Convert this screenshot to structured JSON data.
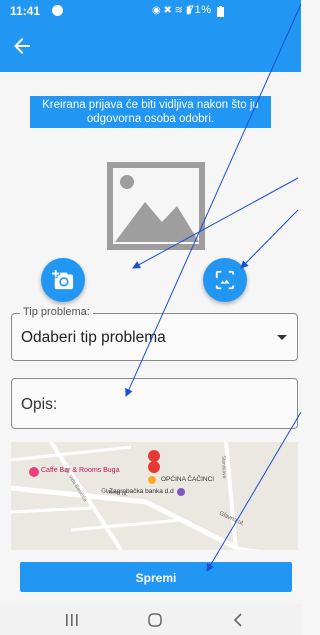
{
  "status_bar": {
    "time": "11:41",
    "battery": "71%"
  },
  "app_bar": {
    "back_icon": "arrow-left-icon"
  },
  "info_banner": {
    "line1": "Kreirana prijava će biti vidljiva nakon što ju",
    "line2": "odgovorna osoba odobri."
  },
  "image_picker": {
    "placeholder_icon": "image-placeholder-icon",
    "camera_icon": "add-camera-icon",
    "gallery_icon": "photo-gallery-icon"
  },
  "form": {
    "problem_type_label": "Tip problema:",
    "problem_type_value": "Odaberi tip problema",
    "description_placeholder": "Opis:"
  },
  "map": {
    "poi_1": "Caffe Bar & Rooms Buga",
    "poi_2": "OPĆINA ČAČINCI",
    "poi_3": "Zagrebačka banka d.d",
    "street_1": "Glavna ul.",
    "street_2": "Glavna ul.",
    "street_3": "Sv. Vida Beničića",
    "street_4": "Stanislava"
  },
  "actions": {
    "save_label": "Spremi"
  },
  "nav_bar": {
    "recent_icon": "recent-apps-icon",
    "home_icon": "home-icon",
    "back_icon": "back-icon"
  },
  "colors": {
    "primary": "#2196f3",
    "annotation": "#1a4fd6",
    "map_pin": "#e53935"
  }
}
